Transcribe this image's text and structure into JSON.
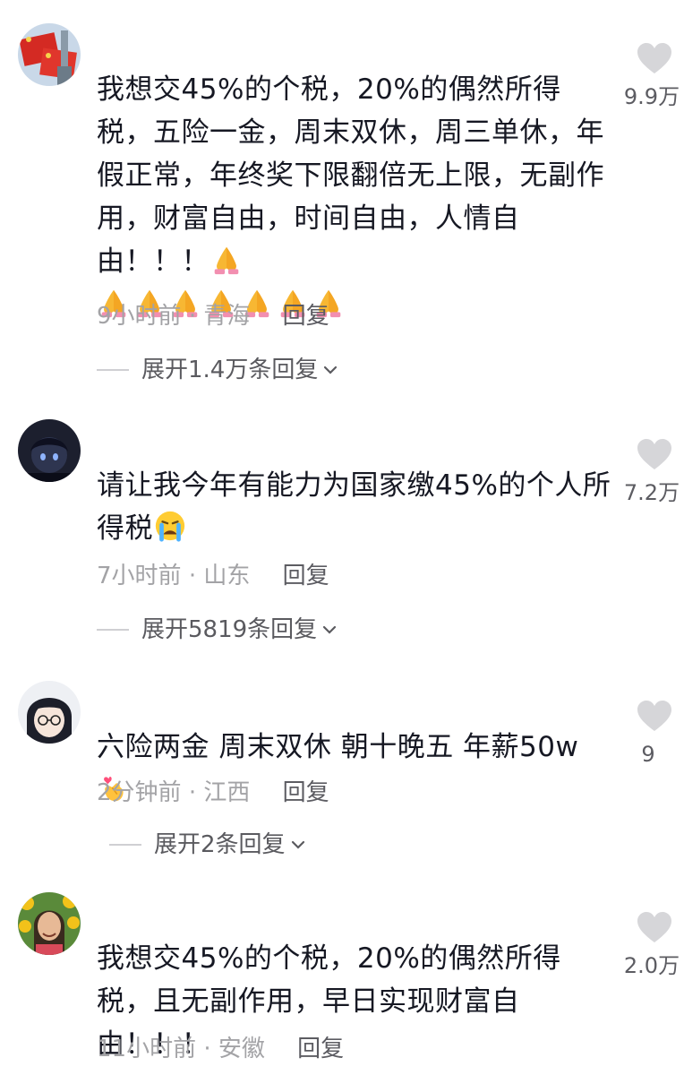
{
  "comments": [
    {
      "text": "我想交45%的个税，20%的偶然所得税，五险一金，周末双休，周三单休，年假正常，年终奖下限翻倍无上限，无副作用，财富自由，时间自由，人情自由！！！",
      "emoji_after": "🙏",
      "emoji_line": [
        "🙏",
        "🙏",
        "🙏",
        "🙏",
        "🙏",
        "🙏",
        "🙏"
      ],
      "time": "9小时前",
      "location": "青海",
      "reply_label": "回复",
      "expand_label": "展开1.4万条回复",
      "likes": "9.9万",
      "avatar_icon": "flag-avatar"
    },
    {
      "text": "请让我今年有能力为国家缴45%的个人所得税",
      "emoji_after": "😭",
      "time": "7小时前",
      "location": "山东",
      "reply_label": "回复",
      "expand_label": "展开5819条回复",
      "likes": "7.2万",
      "avatar_icon": "anime-dark-avatar"
    },
    {
      "text": "六险两金 周末双休 朝十晚五 年薪50w",
      "emoji_after": "🫰",
      "time": "2分钟前",
      "location": "江西",
      "reply_label": "回复",
      "expand_label": "展开2条回复",
      "likes": "9",
      "avatar_icon": "anime-glasses-avatar"
    },
    {
      "text": "我想交45%的个税，20%的偶然所得税，且无副作用，早日实现财富自由！！！",
      "time": "11小时前",
      "location": "安徽",
      "reply_label": "回复",
      "likes": "2.0万",
      "avatar_icon": "sunflower-photo-avatar"
    }
  ],
  "colors": {
    "text": "#161823",
    "meta": "#a3a3a6",
    "heart": "#d6d6d9"
  }
}
